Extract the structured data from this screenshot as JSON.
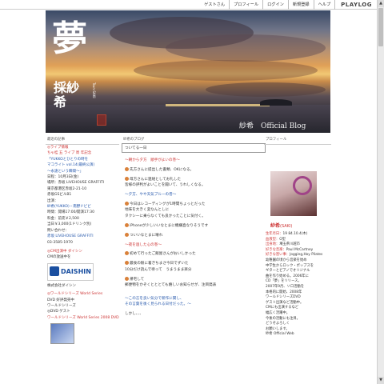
{
  "topbar": {
    "links": [
      "ゲストさん",
      "プロフィール",
      "ログイン",
      "新規登録",
      "ヘルプ"
    ],
    "brand": "PLAYLOG"
  },
  "banner": {
    "kanji": "夢",
    "name_line1": "採紗",
    "name_line2": "希",
    "vertical": "Tsun-SAKI",
    "caption": "紗希　Official Blog"
  },
  "left": {
    "header": "最近の記事",
    "lines": [
      {
        "text": "◎ライブ情報",
        "cls": "red"
      },
      {
        "text": "ちゃ桂 五 ライブ 周 年記念",
        "cls": "red"
      },
      {
        "text": "「YUKKOとひとりの時を",
        "cls": "blue"
      },
      {
        "text": "マコライト vol.14(最終公演)",
        "cls": "blue"
      },
      {
        "text": "〜永遠という瞬間〜」",
        "cls": "blue"
      },
      {
        "text": "日程：10月3日(金)",
        "cls": ""
      },
      {
        "text": "場所：赤坂 LIVEHOUSE GRAFFITI",
        "cls": ""
      },
      {
        "text": "東京都港区赤坂2-21-10",
        "cls": ""
      },
      {
        "text": "赤坂GSビルB1",
        "cls": ""
      },
      {
        "text": "出演：",
        "cls": ""
      },
      {
        "text": "紗希(YUKKO)・南野ドビビ",
        "cls": "blue"
      },
      {
        "text": "時間：開場17:00/開演17:30",
        "cls": ""
      },
      {
        "text": "料金：前売￥2,500",
        "cls": ""
      },
      {
        "text": "当日￥3,000(1ドリンク別)",
        "cls": ""
      },
      {
        "text": "問い合わせ：",
        "cls": ""
      },
      {
        "text": "赤坂 LIVEHOUSE GRAFFITI",
        "cls": "blue"
      },
      {
        "text": "03-3585-1970",
        "cls": ""
      }
    ],
    "cm_title": "◎CM出演中 ダイシン",
    "cm_sub": "CMの放送中を",
    "banner_text": "DAISHIN",
    "banner_sub": "株式会社ダイシン",
    "tv_title": "◎ワールドシリーズ World Series",
    "tv_line1": "DVD 好評発売中",
    "tv_line2": "ワールドシリーズ",
    "tv_line3": "◎DVD ゲスト",
    "tv_line4": "ワールドシリーズ World Series 2008 DVD"
  },
  "main": {
    "tab": "紗希のブログ",
    "title": "ついてる一日",
    "lines": [
      {
        "t": "〜朝から夕方　順手がよいの巻〜",
        "c": "red"
      },
      {
        "t": "",
        "c": "gap"
      },
      {
        "t": "先方さんに提出した書類、OKになる。",
        "c": "",
        "e": true
      },
      {
        "t": "",
        "c": "gap"
      },
      {
        "t": "母方さんに連絡としてお礼した",
        "c": "",
        "e": true
      },
      {
        "t": "皆様の評判がよいことを聞いて、うれしくなる。",
        "c": ""
      },
      {
        "t": "",
        "c": "gap"
      },
      {
        "t": "〜夕方、やや天気ブルーの巻〜",
        "c": "blue"
      },
      {
        "t": "",
        "c": "gap"
      },
      {
        "t": "今日はレコーディングが1時間ちょっとだった",
        "c": "",
        "e": true
      },
      {
        "t": "地味を大きく変なんとしに",
        "c": ""
      },
      {
        "t": "タクシーに乗らなくても良かったことに気付く。",
        "c": ""
      },
      {
        "t": "",
        "c": "gap"
      },
      {
        "t": "iPhoneが少しいいなとまに機嫌直なりそうです",
        "c": "",
        "e": true
      },
      {
        "t": "",
        "c": "gap"
      },
      {
        "t": "ついいなとまに壊れ",
        "c": "",
        "e": true
      },
      {
        "t": "",
        "c": "gap"
      },
      {
        "t": "〜夜を過した心の巻〜",
        "c": "red"
      },
      {
        "t": "",
        "c": "gap"
      },
      {
        "t": "初めて行ったご飯屋さんがおいしかった",
        "c": "",
        "e": true
      },
      {
        "t": "",
        "c": "gap"
      },
      {
        "t": "最後の駅に着きちまさ今日でずいた",
        "c": "",
        "e": true
      },
      {
        "t": "10分だけ読んで待って　うまうまま楽分",
        "c": ""
      },
      {
        "t": "",
        "c": "gap"
      },
      {
        "t": "帰宅して",
        "c": "",
        "e": true
      },
      {
        "t": "郵便物をかぞくとととても嬉しいお知らせが、注目発表",
        "c": ""
      },
      {
        "t": "",
        "c": "gap"
      },
      {
        "t": "",
        "c": "gap"
      },
      {
        "t": "〜この言を良い気分で新作に関し、",
        "c": "blue"
      },
      {
        "t": "その言葉を後く見られる日付だった。〜",
        "c": "blue"
      },
      {
        "t": "",
        "c": "gap"
      },
      {
        "t": "しかし、、、",
        "c": ""
      }
    ]
  },
  "right": {
    "header": "プロフィール",
    "name": "紗希",
    "name_reading": "(SAKI)",
    "profile": [
      {
        "k": "生年月日",
        "v": "19 84.10.4(木)"
      },
      {
        "k": "血液型",
        "v": "O型"
      },
      {
        "k": "出身地",
        "v": "埼玉県川越市"
      },
      {
        "k": "好きな音楽",
        "v": "Paul McCartney"
      },
      {
        "k": "好きな習い事",
        "v": "Jogging,Hoy Pilates"
      },
      {
        "k": "",
        "v": "幼稚園の頃から音楽を始め"
      },
      {
        "k": "",
        "v": "中学生からロック・ポップスを"
      },
      {
        "k": "",
        "v": "ギターとピアノでオリジナル"
      },
      {
        "k": "",
        "v": "曲を作り始める。2006年に"
      },
      {
        "k": "",
        "v": "CD「夢」をリリース。"
      },
      {
        "k": "",
        "v": "2007年9月、ソロ活動を"
      },
      {
        "k": "",
        "v": "本格的に開始、2008年"
      },
      {
        "k": "",
        "v": "ワールドシリーズDVD"
      },
      {
        "k": "",
        "v": "ゲスト出演など活動中。"
      },
      {
        "k": "",
        "v": "CMにも出演するなど"
      },
      {
        "k": "",
        "v": "幅広く活躍中。"
      },
      {
        "k": "",
        "v": "今後の活動にも注目。"
      },
      {
        "k": "",
        "v": "どうぞよろしく"
      },
      {
        "k": "",
        "v": "お願いします。"
      },
      {
        "k": "",
        "v": "紗希 Official Web"
      }
    ]
  }
}
